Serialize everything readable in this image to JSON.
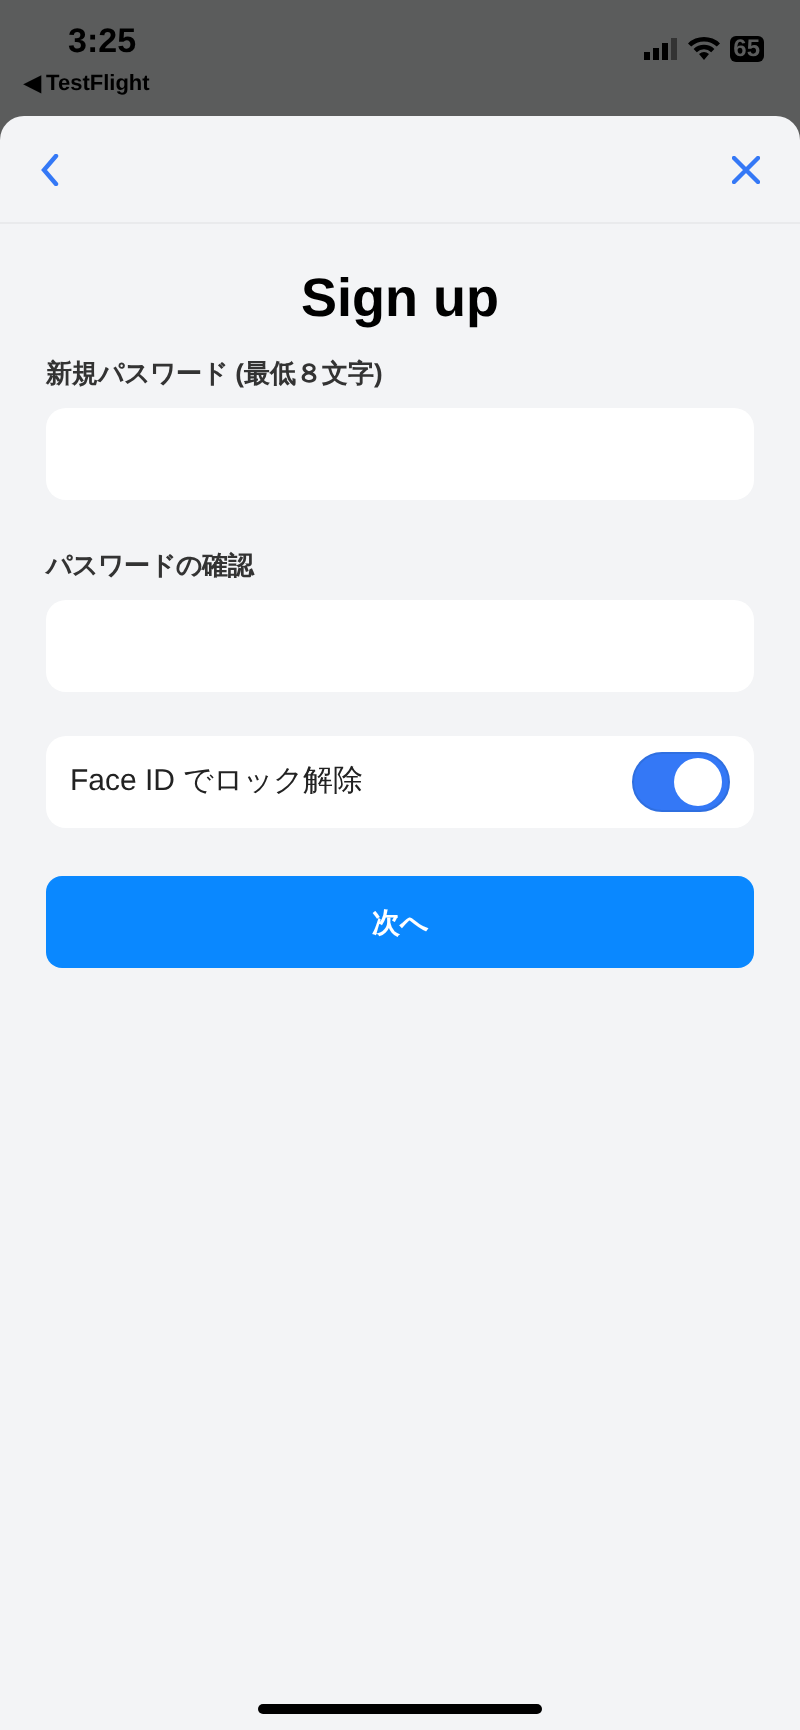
{
  "status_bar": {
    "time": "3:25",
    "back_app": "◀ TestFlight",
    "battery": "65"
  },
  "title": "Sign up",
  "fields": [
    {
      "label": "新規パスワード (最低８文字)"
    },
    {
      "label": "パスワードの確認"
    }
  ],
  "face_id": {
    "label": "Face ID でロック解除",
    "on": true
  },
  "next_button": "次へ"
}
